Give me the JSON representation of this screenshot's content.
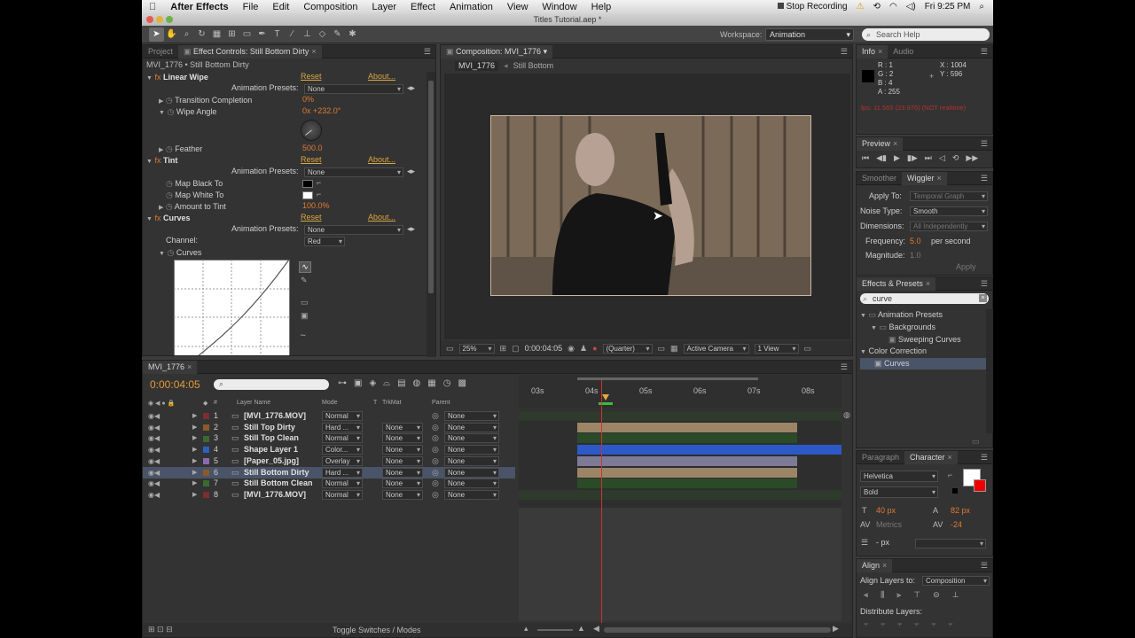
{
  "menubar": {
    "app": "After Effects",
    "items": [
      "File",
      "Edit",
      "Composition",
      "Layer",
      "Effect",
      "Animation",
      "View",
      "Window",
      "Help"
    ],
    "recording": "Stop Recording",
    "clock": "Fri 9:25 PM"
  },
  "window": {
    "title": "Titles Tutorial.aep *"
  },
  "toolbar": {
    "workspace_label": "Workspace:",
    "workspace_value": "Animation",
    "search_placeholder": "Search Help"
  },
  "effect_controls": {
    "tabs": {
      "project": "Project",
      "effect": "Effect Controls: Still Bottom Dirty"
    },
    "breadcrumb": "MVI_1776 • Still Bottom Dirty",
    "reset": "Reset",
    "about": "About...",
    "presets_label": "Animation Presets:",
    "presets_value": "None",
    "linear_wipe": {
      "name": "Linear Wipe",
      "transition_label": "Transition Completion",
      "transition_value": "0%",
      "wipe_angle_label": "Wipe Angle",
      "wipe_angle_value": "0x +232.0°",
      "feather_label": "Feather",
      "feather_value": "500.0"
    },
    "tint": {
      "name": "Tint",
      "map_black": "Map Black To",
      "map_white": "Map White To",
      "amount_label": "Amount to Tint",
      "amount_value": "100.0%"
    },
    "curves": {
      "name": "Curves",
      "channel_label": "Channel:",
      "channel_value": "Red",
      "curves_label": "Curves"
    }
  },
  "composition": {
    "tab": "Composition: MVI_1776",
    "crumb_comp": "MVI_1776",
    "crumb_layer": "Still Bottom",
    "zoom": "25%",
    "timecode": "0:00:04:05",
    "resolution": "(Quarter)",
    "camera": "Active Camera",
    "views": "1 View"
  },
  "info": {
    "tab_info": "Info",
    "tab_audio": "Audio",
    "r": "R : 1",
    "g": "G : 2",
    "b": "B : 4",
    "a": "A : 255",
    "x": "X : 1004",
    "y": "Y : 596",
    "fps_warning": "fps: 11.565 (23.976) (NOT realtime)"
  },
  "preview": {
    "tab": "Preview"
  },
  "wiggler": {
    "tab_smoother": "Smoother",
    "tab_wiggler": "Wiggler",
    "apply_label": "Apply To:",
    "apply_value": "Temporal Graph",
    "noise_label": "Noise Type:",
    "noise_value": "Smooth",
    "dim_label": "Dimensions:",
    "dim_value": "All Independently",
    "freq_label": "Frequency:",
    "freq_value": "5.0",
    "freq_unit": "per second",
    "mag_label": "Magnitude:",
    "mag_value": "1.0",
    "apply_button": "Apply"
  },
  "effects_presets": {
    "tab": "Effects & Presets",
    "search_value": "curve",
    "tree": [
      "Animation Presets",
      "Backgrounds",
      "Sweeping Curves",
      "Color Correction",
      "Curves"
    ]
  },
  "character": {
    "tab_paragraph": "Paragraph",
    "tab_character": "Character",
    "font": "Helvetica",
    "style": "Bold",
    "size": "40 px",
    "leading": "82 px",
    "kerning": "Metrics",
    "tracking": "-24",
    "stroke": "- px"
  },
  "align": {
    "tab": "Align",
    "layers_label": "Align Layers to:",
    "layers_value": "Composition",
    "distribute_label": "Distribute Layers:"
  },
  "timeline": {
    "tab": "MVI_1776",
    "timecode": "0:00:04:05",
    "headers": {
      "name": "Layer Name",
      "mode": "Mode",
      "t": "T",
      "trkmat": "TrkMat",
      "parent": "Parent"
    },
    "ticks": [
      "03s",
      "04s",
      "05s",
      "06s",
      "07s",
      "08s"
    ],
    "footer": "Toggle Switches / Modes",
    "layers": [
      {
        "num": "1",
        "name": "[MVI_1776.MOV]",
        "mode": "Normal",
        "trkmat": "",
        "parent": "None",
        "color": "#7a2e2e"
      },
      {
        "num": "2",
        "name": "Still Top Dirty",
        "mode": "Hard ...",
        "trkmat": "None",
        "parent": "None",
        "color": "#8a5a2a"
      },
      {
        "num": "3",
        "name": "Still Top Clean",
        "mode": "Normal",
        "trkmat": "None",
        "parent": "None",
        "color": "#3a6a2e"
      },
      {
        "num": "4",
        "name": "Shape Layer 1",
        "mode": "Color...",
        "trkmat": "None",
        "parent": "None",
        "color": "#2f5fbf"
      },
      {
        "num": "5",
        "name": "[Paper_05.jpg]",
        "mode": "Overlay",
        "trkmat": "None",
        "parent": "None",
        "color": "#8a6ab0"
      },
      {
        "num": "6",
        "name": "Still Bottom Dirty",
        "mode": "Hard ...",
        "trkmat": "None",
        "parent": "None",
        "color": "#8a5a2a"
      },
      {
        "num": "7",
        "name": "Still Bottom Clean",
        "mode": "Normal",
        "trkmat": "None",
        "parent": "None",
        "color": "#3a6a2e"
      },
      {
        "num": "8",
        "name": "[MVI_1776.MOV]",
        "mode": "Normal",
        "trkmat": "None",
        "parent": "None",
        "color": "#7a2e2e"
      }
    ]
  }
}
